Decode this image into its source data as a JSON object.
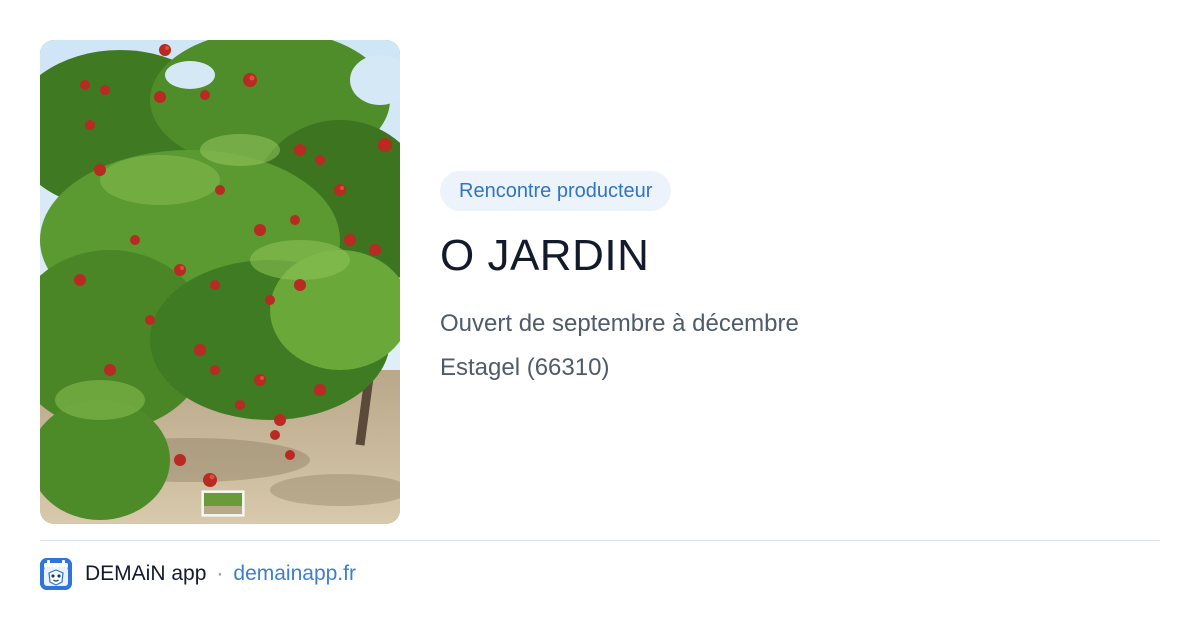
{
  "badge": {
    "label": "Rencontre producteur"
  },
  "title": "O JARDIN",
  "details": {
    "season": "Ouvert de septembre à décembre",
    "location": "Estagel (66310)"
  },
  "photo": {
    "subject": "peach-orchard-image"
  },
  "footer": {
    "app_name": "DEMAiN app",
    "separator": "·",
    "site": "demainapp.fr",
    "app_icon": "demain-app-icon"
  },
  "colors": {
    "accent": "#2f74c7",
    "badge_bg": "#edf3fb",
    "title": "#121a2b",
    "text": "#4f5b6b",
    "link": "#3b7fd0",
    "divider": "#dbe2e8"
  }
}
